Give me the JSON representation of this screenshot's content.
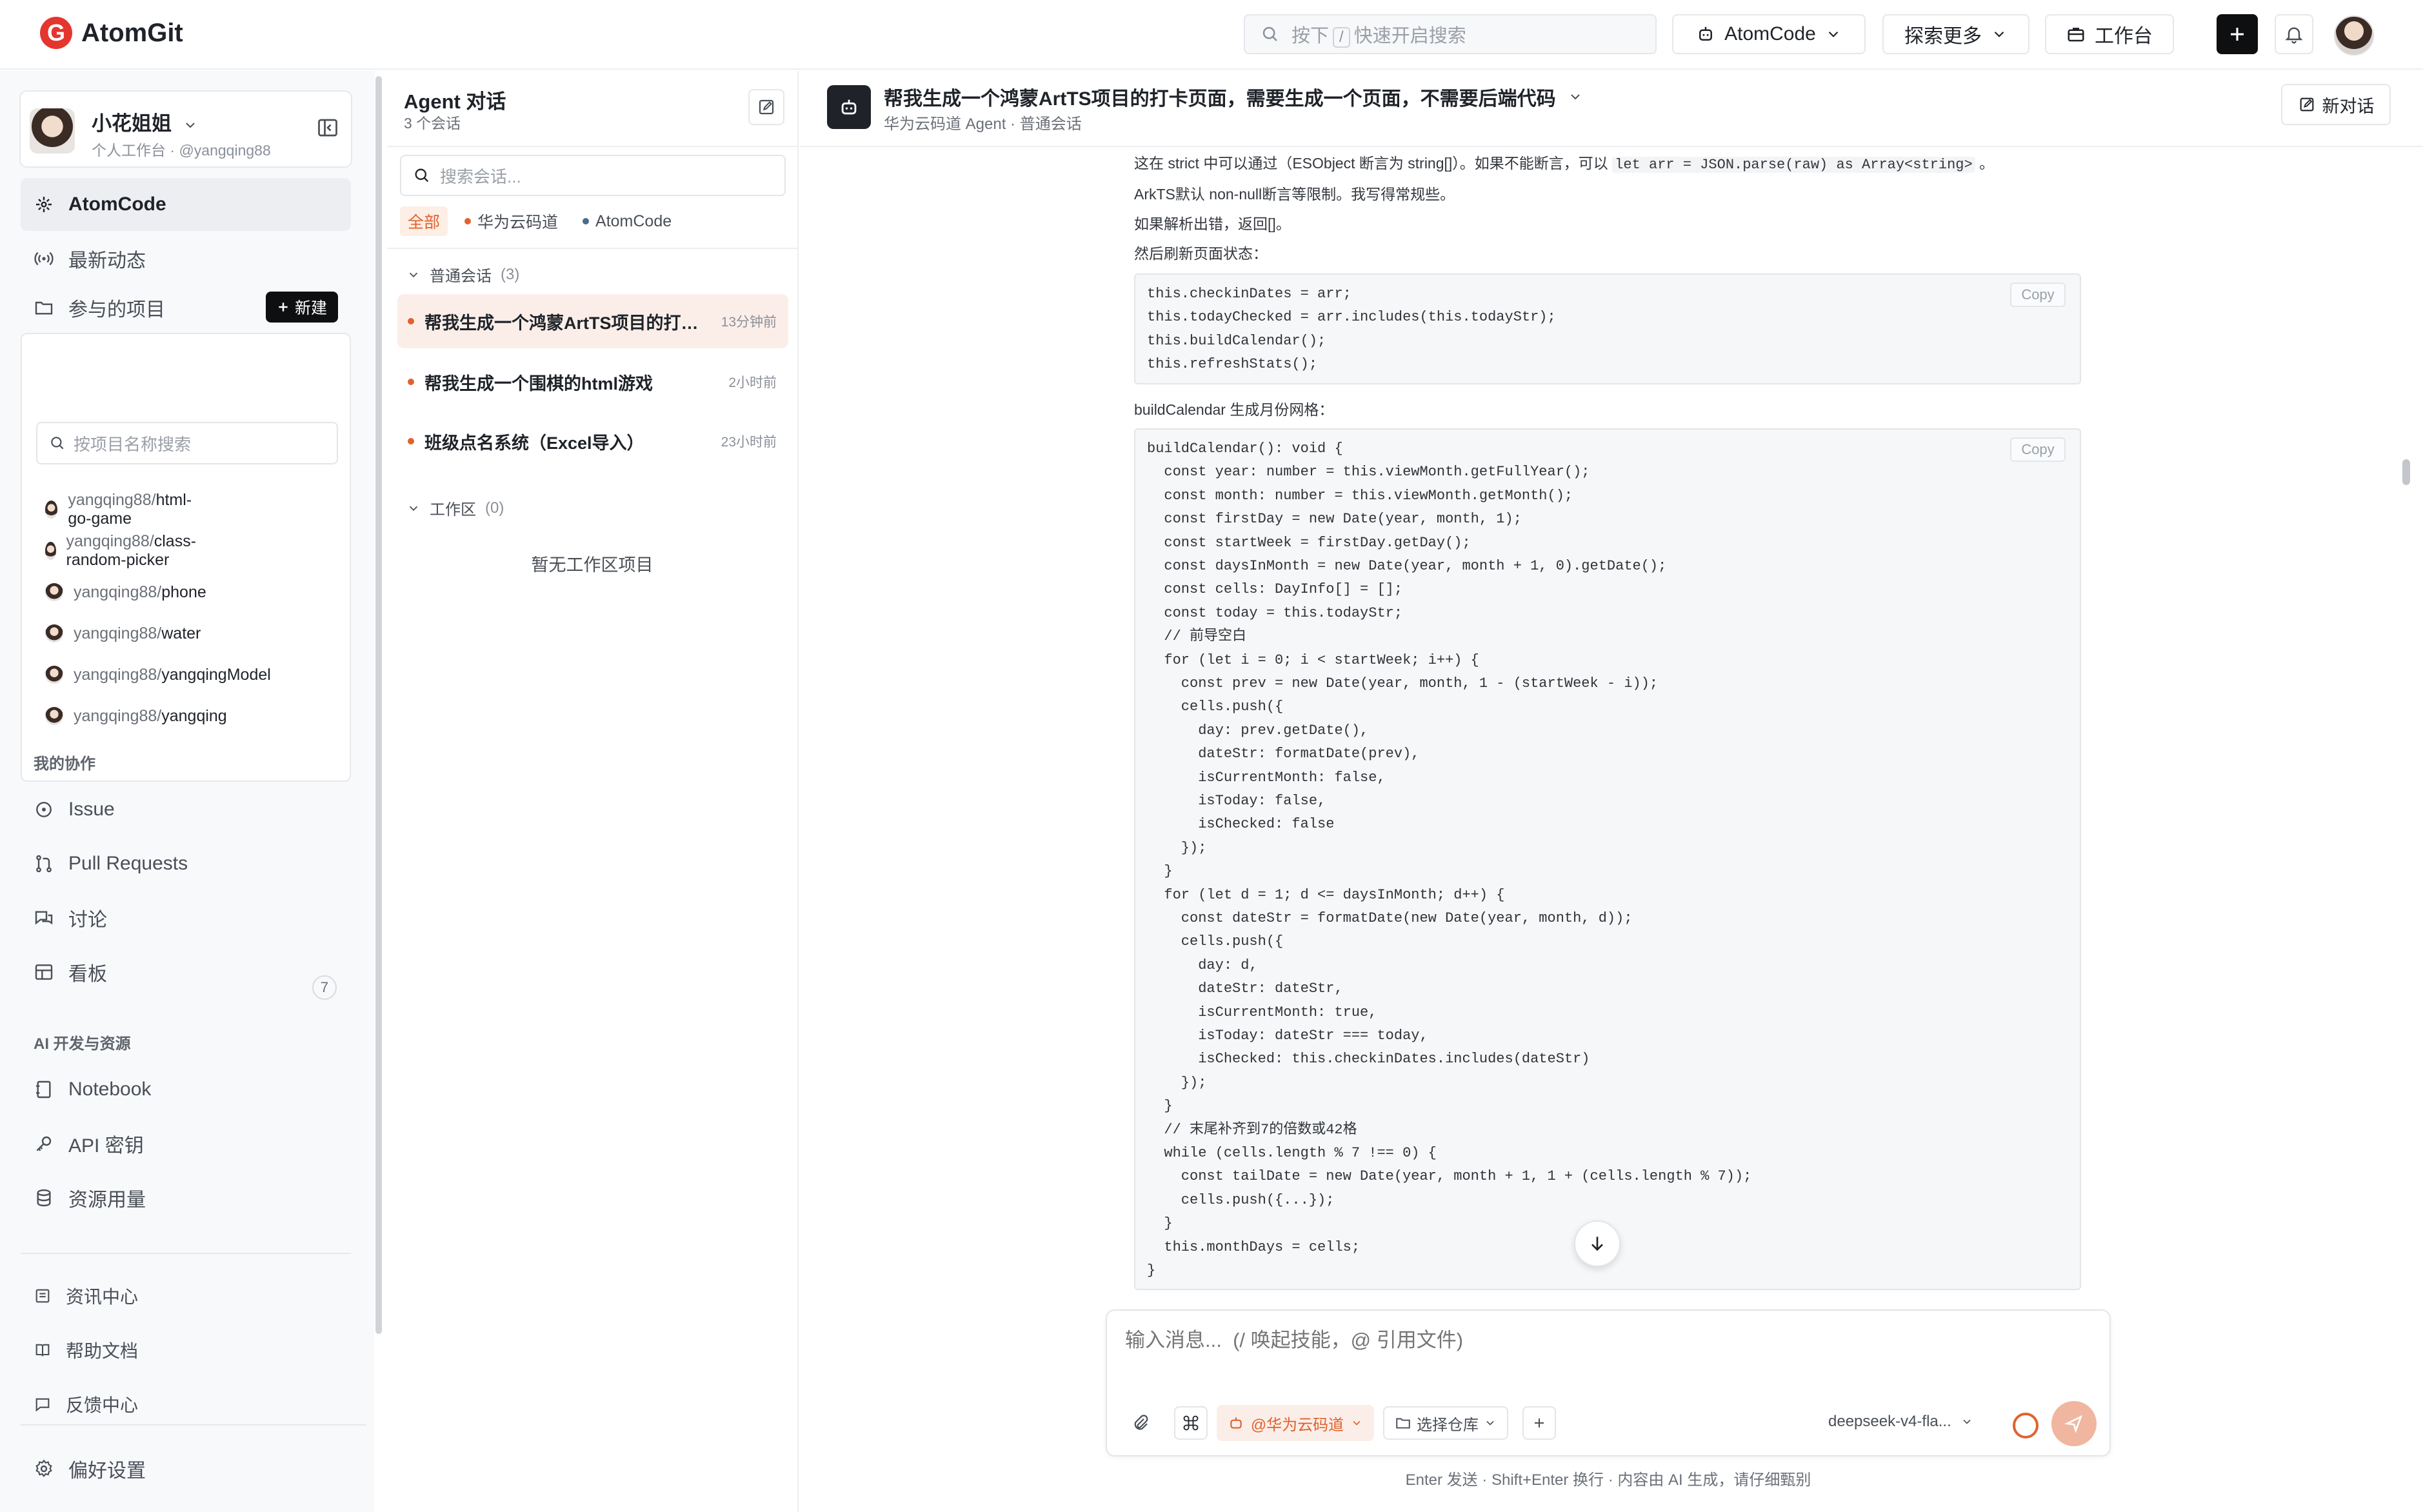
{
  "topbar": {
    "brand": "AtomGit",
    "logo_letter": "G",
    "search_placeholder_prefix": "按下",
    "search_key": "/",
    "search_placeholder_suffix": "快速开启搜索",
    "atomcode_label": "AtomCode",
    "explore_label": "探索更多",
    "workbench_label": "工作台"
  },
  "sidebar": {
    "user_name": "小花姐姐",
    "user_sub": "个人工作台 · @yangqing88",
    "nav_atomcode": "AtomCode",
    "nav_news": "最新动态",
    "nav_projects": "参与的项目",
    "new_button": "新建",
    "project_search_placeholder": "按项目名称搜索",
    "projects": [
      {
        "owner": "yangqing88/",
        "name": "html-go-game"
      },
      {
        "owner": "yangqing88/",
        "name": "class-random-picker"
      },
      {
        "owner": "yangqing88/",
        "name": "phone"
      },
      {
        "owner": "yangqing88/",
        "name": "water"
      },
      {
        "owner": "yangqing88/",
        "name": "yangqingModel"
      },
      {
        "owner": "yangqing88/",
        "name": "yangqing"
      }
    ],
    "section_collab": "我的协作",
    "nav_issue": "Issue",
    "nav_pr": "Pull Requests",
    "nav_discuss": "讨论",
    "discuss_count": "7",
    "nav_board": "看板",
    "section_ai": "AI 开发与资源",
    "nav_notebook": "Notebook",
    "nav_api": "API 密钥",
    "nav_usage": "资源用量",
    "nav_info": "资讯中心",
    "nav_help": "帮助文档",
    "nav_feedback": "反馈中心",
    "nav_prefs": "偏好设置"
  },
  "agent": {
    "title": "Agent 对话",
    "count": "3 个会话",
    "search_placeholder": "搜索会话...",
    "filters": {
      "all": "全部",
      "huawei": "华为云码道",
      "atomcode": "AtomCode"
    },
    "colors": {
      "huawei": "#e0622d",
      "atomcode": "#4a6b8a"
    },
    "group_normal": "普通会话",
    "group_normal_count": "(3)",
    "conversations": [
      {
        "title": "帮我生成一个鸿蒙ArtTS项目的打卡...",
        "time": "13分钟前"
      },
      {
        "title": "帮我生成一个围棋的html游戏",
        "time": "2小时前"
      },
      {
        "title": "班级点名系统（Excel导入）",
        "time": "23小时前"
      }
    ],
    "group_ws": "工作区",
    "group_ws_count": "(0)",
    "empty_ws": "暂无工作区项目"
  },
  "main": {
    "title": "帮我生成一个鸿蒙ArtTS项目的打卡页面，需要生成一个页面，不需要后端代码",
    "subtitle": "华为云码道 Agent · 普通会话",
    "new_chat": "新对话",
    "p1_a": "这在 strict 中可以通过（ESObject 断言为 string[]）。如果不能断言，可以",
    "p1_code": "let arr = JSON.parse(raw) as Array<string>",
    "p1_b": "。",
    "p2": "ArkTS默认 non-null断言等限制。我写得常规些。",
    "p3": "如果解析出错，返回[]。",
    "p4": "然后刷新页面状态：",
    "copy": "Copy",
    "code1": [
      "this.checkinDates = arr;",
      "this.todayChecked = arr.includes(this.todayStr);",
      "this.buildCalendar();",
      "this.refreshStats();"
    ],
    "p5": "buildCalendar 生成月份网格：",
    "code2": [
      "buildCalendar(): void {",
      "  const year: number = this.viewMonth.getFullYear();",
      "  const month: number = this.viewMonth.getMonth();",
      "  const firstDay = new Date(year, month, 1);",
      "  const startWeek = firstDay.getDay();",
      "  const daysInMonth = new Date(year, month + 1, 0).getDate();",
      "  const cells: DayInfo[] = [];",
      "  const today = this.todayStr;",
      "  // 前导空白",
      "  for (let i = 0; i < startWeek; i++) {",
      "    const prev = new Date(year, month, 1 - (startWeek - i));",
      "    cells.push({",
      "      day: prev.getDate(),",
      "      dateStr: formatDate(prev),",
      "      isCurrentMonth: false,",
      "      isToday: false,",
      "      isChecked: false",
      "    });",
      "  }",
      "  for (let d = 1; d <= daysInMonth; d++) {",
      "    const dateStr = formatDate(new Date(year, month, d));",
      "    cells.push({",
      "      day: d,",
      "      dateStr: dateStr,",
      "      isCurrentMonth: true,",
      "      isToday: dateStr === today,",
      "      isChecked: this.checkinDates.includes(dateStr)",
      "    });",
      "  }",
      "  // 末尾补齐到7的倍数或42格",
      "  while (cells.length % 7 !== 0) {",
      "    const tailDate = new Date(year, month + 1, 1 + (cells.length % 7));",
      "    cells.push({...});",
      "  }",
      "  this.monthDays = cells;",
      "}"
    ]
  },
  "composer": {
    "placeholder": "输入消息...  (/ 唤起技能，@ 引用文件)",
    "chip_huawei": "@华为云码道",
    "select_repo": "选择仓库",
    "model": "deepseek-v4-fla...",
    "footer": "Enter 发送 · Shift+Enter 换行 · 内容由 AI 生成，请仔细甄别"
  }
}
